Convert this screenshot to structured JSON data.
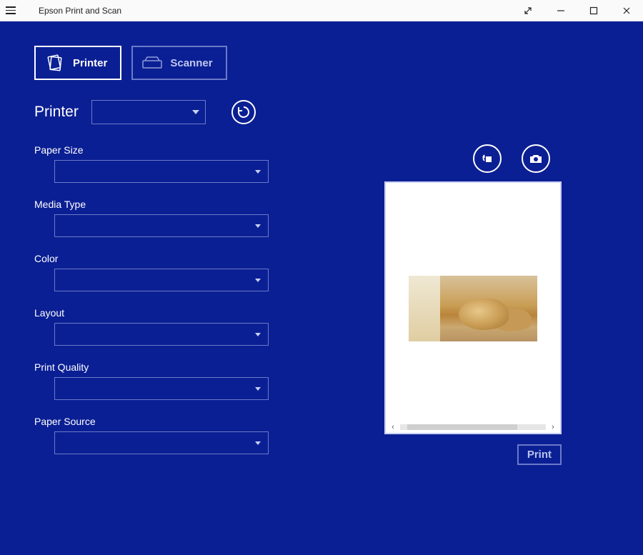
{
  "window": {
    "title": "Epson Print and Scan"
  },
  "tabs": {
    "printer": "Printer",
    "scanner": "Scanner"
  },
  "printer_row": {
    "label": "Printer",
    "selected": ""
  },
  "fields": {
    "paper_size": {
      "label": "Paper Size",
      "value": ""
    },
    "media_type": {
      "label": "Media Type",
      "value": ""
    },
    "color": {
      "label": "Color",
      "value": ""
    },
    "layout": {
      "label": "Layout",
      "value": ""
    },
    "print_quality": {
      "label": "Print Quality",
      "value": ""
    },
    "paper_source": {
      "label": "Paper Source",
      "value": ""
    }
  },
  "actions": {
    "print": "Print"
  },
  "icons": {
    "refresh": "refresh-icon",
    "rotate": "rotate-icon",
    "camera": "camera-icon"
  }
}
